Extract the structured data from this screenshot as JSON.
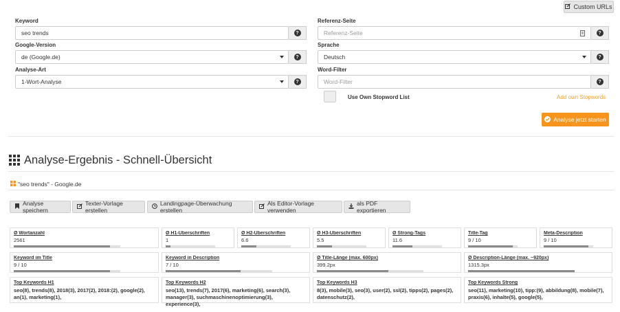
{
  "header": {
    "custom_urls_label": "Custom URLs"
  },
  "form": {
    "keyword_label": "Keyword",
    "keyword_value": "seo trends",
    "google_version_label": "Google-Version",
    "google_version_value": "de (Google.de)",
    "analysis_type_label": "Analyse-Art",
    "analysis_type_value": "1-Wort-Analyse",
    "reference_label": "Referenz-Seite",
    "reference_placeholder": "Referenz-Seite",
    "language_label": "Sprache",
    "language_value": "Deutsch",
    "word_filter_label": "Word-Filter",
    "word_filter_placeholder": "Word-Filter",
    "stopword_label": "Use Own Stopword List",
    "add_stopwords_label": "Add own Stopwords",
    "start_label": "Analyse jetzt starten",
    "help_glyph": "?"
  },
  "result": {
    "title": "Analyse-Ergebnis - Schnell-Übersicht",
    "subtitle": "\"seo trends\" - Google.de"
  },
  "toolbar": {
    "save": "Analyse speichern",
    "template": "Texter-Vorlage erstellen",
    "monitor": "Landingpage-Überwachung erstellen",
    "editor": "Als Editor-Vorlage verwenden",
    "pdf": "als PDF exportieren"
  },
  "cards_row1": [
    {
      "title": "Ø Wortanzahl",
      "value": "2561",
      "fill": 0.9
    },
    {
      "title": "Ø H1-Überschriften",
      "value": "1",
      "fill": 0.1
    },
    {
      "title": "Ø H2-Überschriften",
      "value": "6.6",
      "fill": 0.3
    },
    {
      "title": "Ø H3-Überschriften",
      "value": "5.5",
      "fill": 0.3
    },
    {
      "title": "Ø Strong-Tags",
      "value": "11.6",
      "fill": 0.4
    },
    {
      "title": "Title-Tag",
      "value": "9 / 10",
      "fill": 0.9
    },
    {
      "title": "Meta-Description",
      "value": "9 / 10",
      "fill": 0.9
    }
  ],
  "cards_row2": [
    {
      "title": "Keyword im Title",
      "value": "9 / 10",
      "fill": 0.9
    },
    {
      "title": "Keyword in Description",
      "value": "7 / 10",
      "fill": 0.7
    },
    {
      "title": "Ø Title-Länge (max. 600px)",
      "value": "399.2px",
      "fill": 0.67
    },
    {
      "title": "Ø Description-Länge (max. ~920px)",
      "value": "1315.3px",
      "fill": 1.0
    }
  ],
  "cards_row3": [
    {
      "title": "Top Keywords H1",
      "text": "seo(8), trends(8), 2018(3), 2017(2), 2018:(2), google(2), an(1), marketing(1),"
    },
    {
      "title": "Top Keywords H2",
      "text": "seo(13), trends(7), 2017(6), marketing(6), search(3), manager(3), suchmaschinenoptimierung(3), experience(3),"
    },
    {
      "title": "Top Keywords H3",
      "text": "8(3), mobile(3), seo(3), user(2), ssl(2), tipps(2), pages(2), datenschutz(2),"
    },
    {
      "title": "Top Keywords Strong",
      "text": "seo(11), marketing(10), tipp:(9), abbildung(8), mobile(7), praxis(6), inhalte(5), google(5),"
    }
  ]
}
